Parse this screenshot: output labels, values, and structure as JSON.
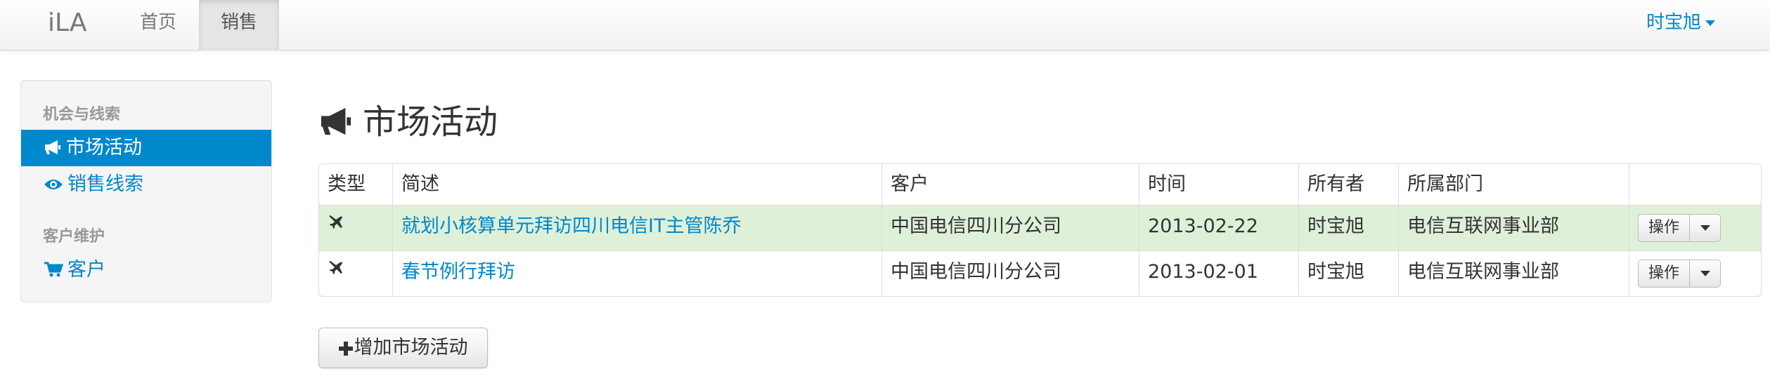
{
  "navbar": {
    "brand": "iLA",
    "items": [
      {
        "label": "首页"
      },
      {
        "label": "销售",
        "active": true
      }
    ],
    "user": "时宝旭"
  },
  "sidebar": {
    "sections": [
      {
        "header": "机会与线索",
        "items": [
          {
            "label": "市场活动",
            "icon": "bullhorn-icon",
            "active": true
          },
          {
            "label": "销售线索",
            "icon": "eye-icon"
          }
        ]
      },
      {
        "header": "客户维护",
        "items": [
          {
            "label": "客户",
            "icon": "shopping-cart-icon"
          }
        ]
      }
    ]
  },
  "page": {
    "title": "市场活动",
    "title_icon": "bullhorn-icon"
  },
  "table": {
    "columns": [
      "类型",
      "简述",
      "客户",
      "时间",
      "所有者",
      "所属部门",
      ""
    ],
    "rows": [
      {
        "type_icon": "plane-icon",
        "summary": "就划小核算单元拜访四川电信IT主管陈乔",
        "customer": "中国电信四川分公司",
        "date": "2013-02-22",
        "owner": "时宝旭",
        "department": "电信互联网事业部",
        "action": "操作",
        "highlight": true
      },
      {
        "type_icon": "plane-icon",
        "summary": "春节例行拜访",
        "customer": "中国电信四川分公司",
        "date": "2013-02-01",
        "owner": "时宝旭",
        "department": "电信互联网事业部",
        "action": "操作",
        "highlight": false
      }
    ]
  },
  "add_button": {
    "label": "增加市场活动",
    "icon": "plus-icon"
  },
  "colors": {
    "link": "#0088cc",
    "active_bg": "#0088cc",
    "row_highlight": "#dff0d8",
    "navbar_bg": "#f7f7f7"
  }
}
